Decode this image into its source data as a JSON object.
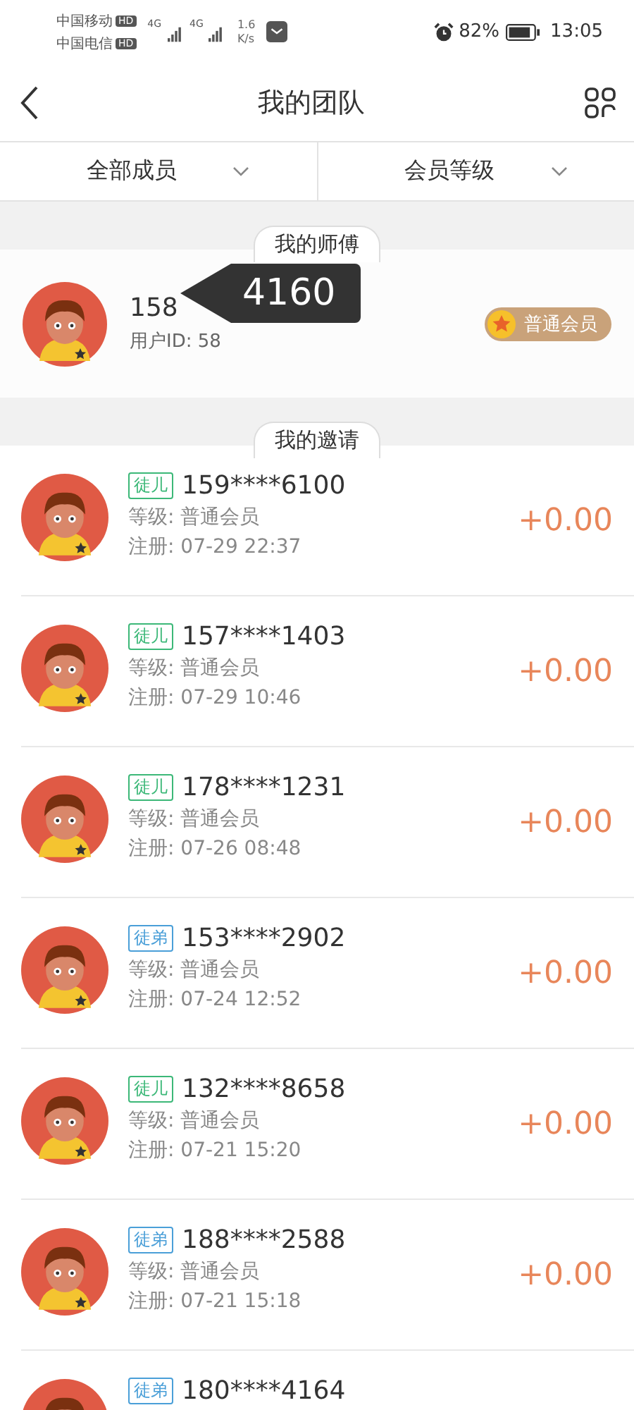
{
  "status_bar": {
    "carriers": [
      "中国移动",
      "中国电信"
    ],
    "hd": [
      "HD",
      "HD"
    ],
    "network": [
      "4G",
      "4G"
    ],
    "speed": [
      "1.6",
      "K/s"
    ],
    "battery": "82%",
    "time": "13:05"
  },
  "header": {
    "title": "我的团队"
  },
  "filters": [
    {
      "label": "全部成员"
    },
    {
      "label": "会员等级"
    }
  ],
  "master": {
    "section": "我的师傅",
    "phone": "158",
    "user_id": "用户ID: 58",
    "badge": "普通会员",
    "tooltip": "4160"
  },
  "invites": {
    "section": "我的邀请",
    "rows": [
      {
        "tag": "徒儿",
        "color": "#3cb878",
        "phone": "159****6100",
        "level": "等级: 普通会员",
        "registered": "注册: 07-29 22:37",
        "amount": "+0.00"
      },
      {
        "tag": "徒儿",
        "color": "#3cb878",
        "phone": "157****1403",
        "level": "等级: 普通会员",
        "registered": "注册: 07-29 10:46",
        "amount": "+0.00"
      },
      {
        "tag": "徒儿",
        "color": "#3cb878",
        "phone": "178****1231",
        "level": "等级: 普通会员",
        "registered": "注册: 07-26 08:48",
        "amount": "+0.00"
      },
      {
        "tag": "徒弟",
        "color": "#4a9fd8",
        "phone": "153****2902",
        "level": "等级: 普通会员",
        "registered": "注册: 07-24 12:52",
        "amount": "+0.00"
      },
      {
        "tag": "徒儿",
        "color": "#3cb878",
        "phone": "132****8658",
        "level": "等级: 普通会员",
        "registered": "注册: 07-21 15:20",
        "amount": "+0.00"
      },
      {
        "tag": "徒弟",
        "color": "#4a9fd8",
        "phone": "188****2588",
        "level": "等级: 普通会员",
        "registered": "注册: 07-21 15:18",
        "amount": "+0.00"
      },
      {
        "tag": "徒弟",
        "color": "#4a9fd8",
        "phone": "180****4164"
      }
    ]
  }
}
